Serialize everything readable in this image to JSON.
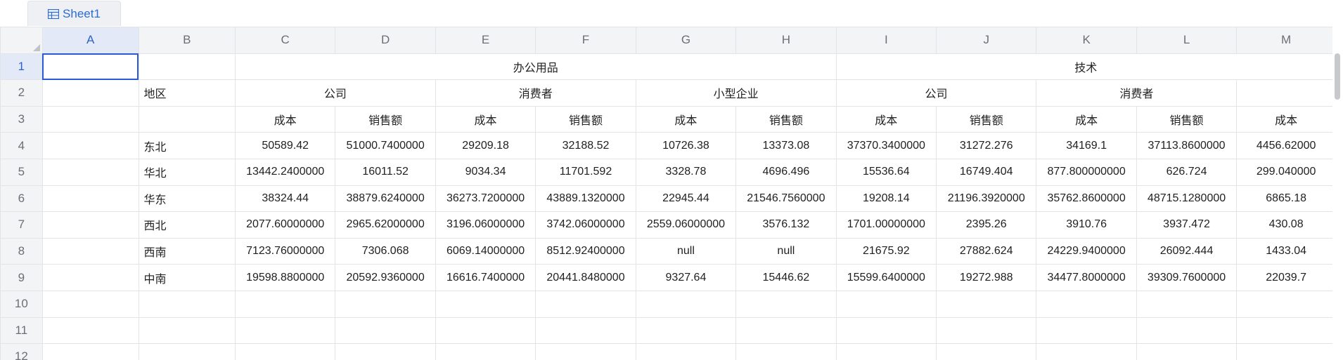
{
  "sheet_tab": {
    "label": "Sheet1",
    "icon": "table-icon"
  },
  "colors": {
    "accent": "#2b58d6",
    "header_bg": "#f3f4f6"
  },
  "columns": [
    "A",
    "B",
    "C",
    "D",
    "E",
    "F",
    "G",
    "H",
    "I",
    "J",
    "K",
    "L",
    "M"
  ],
  "rows_visible": [
    "1",
    "2",
    "3",
    "4",
    "5",
    "6",
    "7",
    "8",
    "9",
    "10",
    "11",
    "12"
  ],
  "header": {
    "region": "地区",
    "level1": [
      "办公用品",
      "技术"
    ],
    "level2": [
      "公司",
      "消费者",
      "小型企业",
      "公司",
      "消费者"
    ],
    "level3": [
      "成本",
      "销售额",
      "成本",
      "销售额",
      "成本",
      "销售额",
      "成本",
      "销售额",
      "成本",
      "销售额",
      "成本"
    ]
  },
  "data": [
    {
      "region": "东北",
      "values": [
        "50589.42",
        "51000.7400000",
        "29209.18",
        "32188.52",
        "10726.38",
        "13373.08",
        "37370.3400000",
        "31272.276",
        "34169.1",
        "37113.8600000",
        "4456.62000"
      ]
    },
    {
      "region": "华北",
      "values": [
        "13442.2400000",
        "16011.52",
        "9034.34",
        "11701.592",
        "3328.78",
        "4696.496",
        "15536.64",
        "16749.404",
        "877.800000000",
        "626.724",
        "299.040000"
      ]
    },
    {
      "region": "华东",
      "values": [
        "38324.44",
        "38879.6240000",
        "36273.7200000",
        "43889.1320000",
        "22945.44",
        "21546.7560000",
        "19208.14",
        "21196.3920000",
        "35762.8600000",
        "48715.1280000",
        "6865.18"
      ]
    },
    {
      "region": "西北",
      "values": [
        "2077.60000000",
        "2965.62000000",
        "3196.06000000",
        "3742.06000000",
        "2559.06000000",
        "3576.132",
        "1701.00000000",
        "2395.26",
        "3910.76",
        "3937.472",
        "430.08"
      ]
    },
    {
      "region": "西南",
      "values": [
        "7123.76000000",
        "7306.068",
        "6069.14000000",
        "8512.92400000",
        "null",
        "null",
        "21675.92",
        "27882.624",
        "24229.9400000",
        "26092.444",
        "1433.04"
      ]
    },
    {
      "region": "中南",
      "values": [
        "19598.8800000",
        "20592.9360000",
        "16616.7400000",
        "20441.8480000",
        "9327.64",
        "15446.62",
        "15599.6400000",
        "19272.988",
        "34477.8000000",
        "39309.7600000",
        "22039.7"
      ]
    }
  ]
}
